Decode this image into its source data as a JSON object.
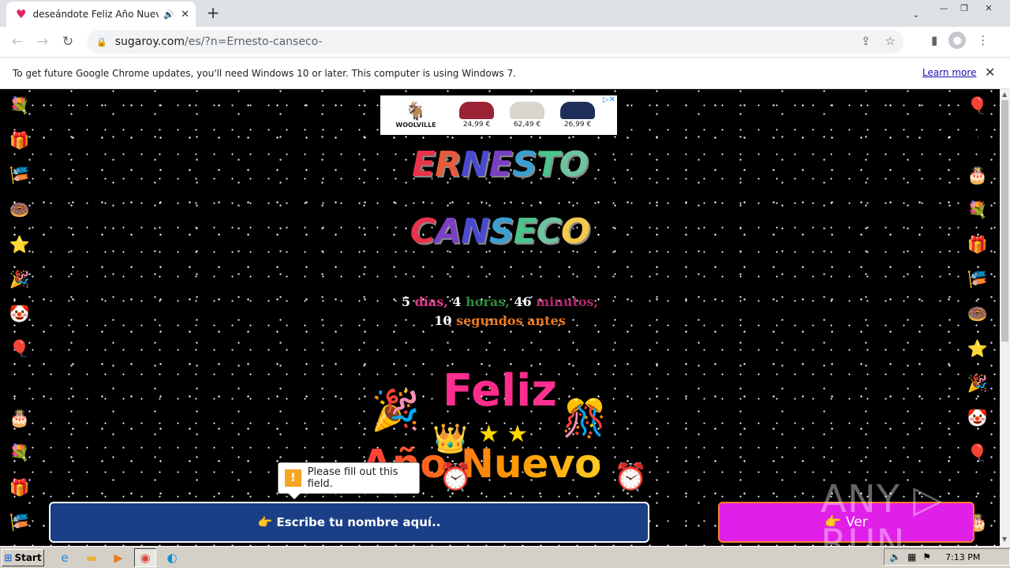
{
  "browser": {
    "tab_title": "deseándote Feliz Año Nuevo 20",
    "new_tab_label": "+",
    "url_domain": "sugaroy.com",
    "url_path": "/es/?n=Ernesto-canseco-"
  },
  "infobar": {
    "message": "To get future Google Chrome updates, you'll need Windows 10 or later. This computer is using Windows 7.",
    "learn_more": "Learn more"
  },
  "ad": {
    "brand": "WOOLVILLE",
    "prices": [
      "24,99 €",
      "62,49 €",
      "26,99 €"
    ],
    "colors": [
      "#9b2335",
      "#d9d4cc",
      "#1f2f5a"
    ]
  },
  "greeting": {
    "first_name": [
      "E",
      "R",
      "N",
      "E",
      "S",
      "T",
      "O"
    ],
    "last_name": [
      "C",
      "A",
      "N",
      "S",
      "E",
      "C",
      "O"
    ],
    "letter_colors": [
      "#e8334a",
      "#e85a3a",
      "#4a4ad0",
      "#7a3fc4",
      "#3aa0d0",
      "#4ac48a",
      "#6fc4a0"
    ],
    "last_colors": [
      "#e8334a",
      "#7a3fc4",
      "#4a4ad0",
      "#3aa0d0",
      "#4ac48a",
      "#6fc4a0",
      "#f2c94c"
    ],
    "countdown_days": "5",
    "countdown_days_label": "días,",
    "countdown_hours": "4",
    "countdown_hours_label": "horas,",
    "countdown_minutes": "46",
    "countdown_minutes_label": "minutos,",
    "countdown_seconds": "10",
    "countdown_seconds_label": "segundos antes",
    "feliz": "Feliz",
    "anio_nuevo": "Año Nuevo"
  },
  "form": {
    "tooltip": "Please fill out this field.",
    "name_button": "👉 Escribe tu nombre aquí..",
    "ver_button": "👉 Ver"
  },
  "side_icons": [
    "💐",
    "🎁",
    "🎏",
    "🍩",
    "⭐",
    "🎉",
    "🤡",
    "🎈",
    "❤",
    "🎂",
    "💐",
    "🎁",
    "🎏"
  ],
  "side_icons_right": [
    "🎈",
    "❤",
    "🎂",
    "💐",
    "🎁",
    "🎏",
    "🍩",
    "⭐",
    "🎉",
    "🤡",
    "🎈",
    "❤",
    "🎂"
  ],
  "watermark": "ANY ▷ RUN",
  "taskbar": {
    "start_label": "Start",
    "time": "7:13 PM"
  }
}
